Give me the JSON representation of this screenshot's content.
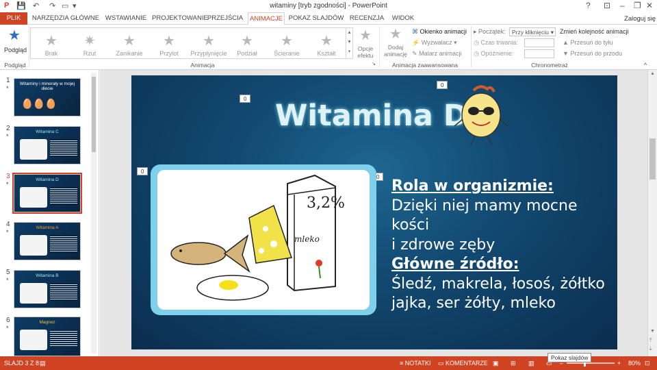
{
  "titlebar": {
    "title": "witaminy [tryb zgodności] - PowerPoint",
    "help": "?",
    "minimize": "–",
    "restore": "❐",
    "close": "✕"
  },
  "tabs": [
    {
      "label": "PLIK"
    },
    {
      "label": "NARZĘDZIA GŁÓWNE"
    },
    {
      "label": "WSTAWIANIE"
    },
    {
      "label": "PROJEKTOWANIE"
    },
    {
      "label": "PRZEJŚCIA"
    },
    {
      "label": "ANIMACJE"
    },
    {
      "label": "POKAZ SLAJDÓW"
    },
    {
      "label": "RECENZJA"
    },
    {
      "label": "WIDOK"
    }
  ],
  "login": "Zaloguj się",
  "ribbon": {
    "preview_label": "Podgląd",
    "preview_group": "Podgląd",
    "animations": [
      "Brak",
      "Rzut",
      "Zanikanie",
      "Przylot",
      "Przypłynięcie",
      "Podział",
      "Ścieranie",
      "Kształt"
    ],
    "effect_options": "Opcje efektu",
    "animation_group": "Animacja",
    "add_animation": "Dodaj animację",
    "animation_pane": "Okienko animacji",
    "trigger": "Wyzwalacz",
    "painter": "Malarz animacji",
    "advanced_group": "Animacja zaawansowana",
    "start_label": "Początek:",
    "start_value": "Przy kliknięciu",
    "duration_label": "Czas trwania:",
    "delay_label": "Opóźnienie:",
    "reorder_label": "Zmień kolejność animacji",
    "move_earlier": "Przesuń do tyłu",
    "move_later": "Przesuń do przodu",
    "timing_group": "Chronometraż"
  },
  "thumbnails": [
    {
      "num": "1",
      "star": "*",
      "title": "Witaminy i minerały w mojej diecie"
    },
    {
      "num": "2",
      "star": "*",
      "title": "Witamina C"
    },
    {
      "num": "3",
      "star": "*",
      "title": "Witamina D"
    },
    {
      "num": "4",
      "star": "*",
      "title": "Witamina A"
    },
    {
      "num": "5",
      "star": "*",
      "title": "Witamina B"
    },
    {
      "num": "6",
      "star": "*",
      "title": "Magnez"
    }
  ],
  "slide": {
    "title": "Witamina D",
    "tags": [
      "0",
      "0",
      "0",
      "0"
    ],
    "heading1": "Rola w organizmie:",
    "text1a": "Dzięki niej mamy mocne kości",
    "text1b": "i zdrowe zęby",
    "heading2": "Główne źródło:",
    "text2a": "Śledź, makrela, łosoś, żółtko",
    "text2b": "jajka, ser żółty, mleko",
    "milk_label": "3,2%",
    "milk_word": "mleko"
  },
  "status": {
    "slide_counter": "SLAJD 3 Z 8",
    "notes": "NOTATKI",
    "comments": "KOMENTARZE",
    "zoom": "80%",
    "tooltip": "Pokaz slajdów"
  }
}
